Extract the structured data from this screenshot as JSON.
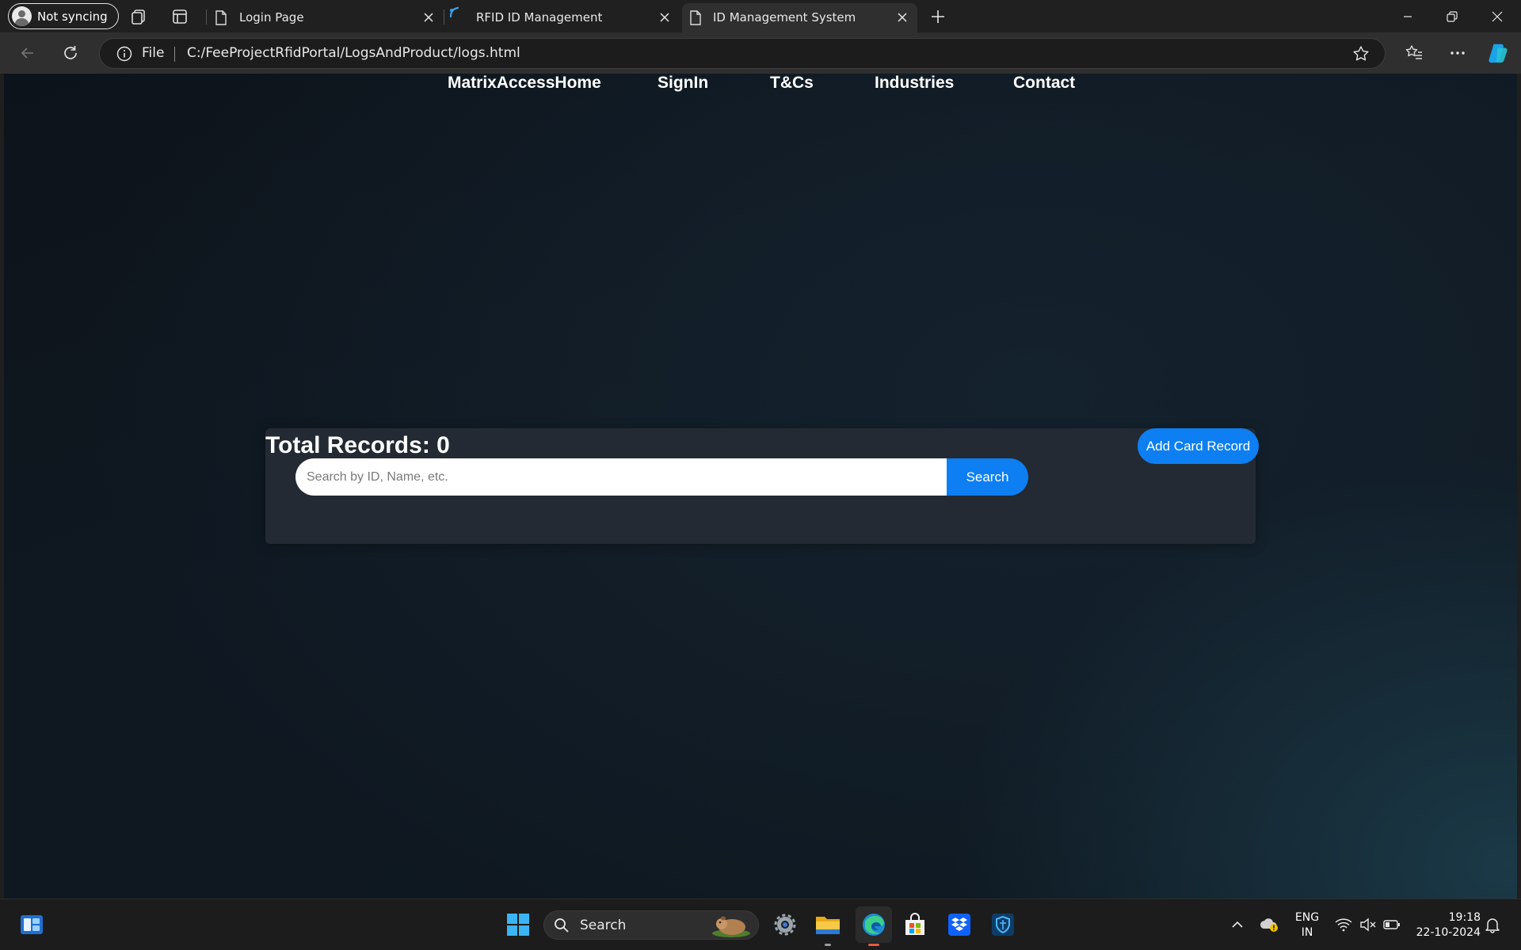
{
  "browser": {
    "profile_label": "Not syncing",
    "tabs": [
      {
        "title": "Login Page"
      },
      {
        "title": "RFID ID Management"
      },
      {
        "title": "ID Management System"
      }
    ],
    "address_scheme": "File",
    "url": "C:/FeeProjectRfidPortal/LogsAndProduct/logs.html"
  },
  "page": {
    "nav": [
      "MatrixAccessHome",
      "SignIn",
      "T&Cs",
      "Industries",
      "Contact"
    ],
    "records_title": "Total Records: 0",
    "add_button": "Add Card Record",
    "search_placeholder": "Search by ID, Name, etc.",
    "search_button": "Search",
    "accent_color": "#0d7ff2"
  },
  "taskbar": {
    "search_label": "Search",
    "language": "ENG",
    "region": "IN",
    "time": "19:18",
    "date": "22-10-2024"
  }
}
